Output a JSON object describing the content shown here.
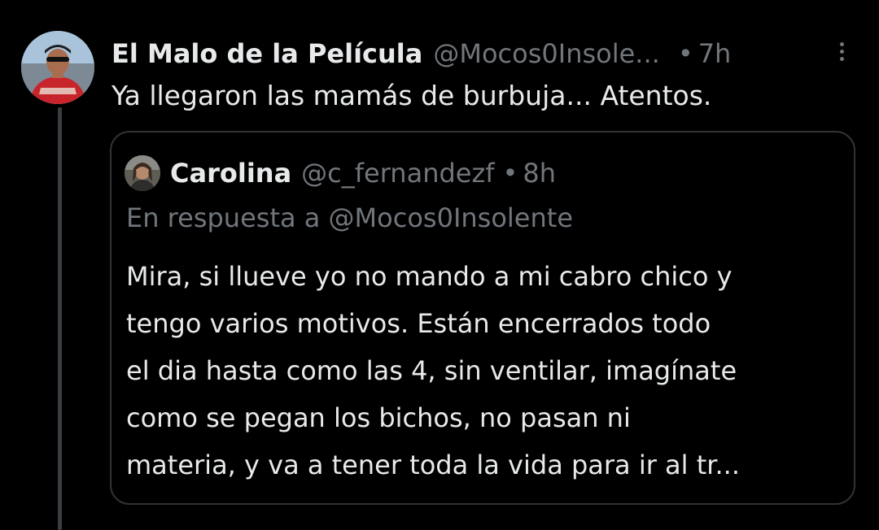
{
  "tweet": {
    "display_name": "El Malo de la Película",
    "handle": "@Mocos0Insole...",
    "separator": "•",
    "time": "7h",
    "text": "Ya llegaron las mamás de burbuja... Atentos."
  },
  "quoted_tweet": {
    "display_name": "Carolina",
    "handle": "@c_fernandezf",
    "separator": "•",
    "time": "8h",
    "reply_to": "En respuesta a @Mocos0Insolente",
    "text_lines": [
      "Mira, si llueve yo no mando a mi cabro chico y",
      "tengo varios motivos. Están encerrados todo",
      "el dia hasta como las 4, sin ventilar, imagínate",
      "como se pegan los bichos, no pasan ni",
      "materia, y va a tener toda la vida para ir al tr..."
    ]
  },
  "icons": {
    "more": "more-vertical-icon",
    "avatar": "user-avatar",
    "quoted_avatar": "quoted-user-avatar"
  },
  "colors": {
    "background": "#000000",
    "primary_text": "#e7e9ea",
    "secondary_text": "#71767b",
    "border": "#2f3336"
  }
}
